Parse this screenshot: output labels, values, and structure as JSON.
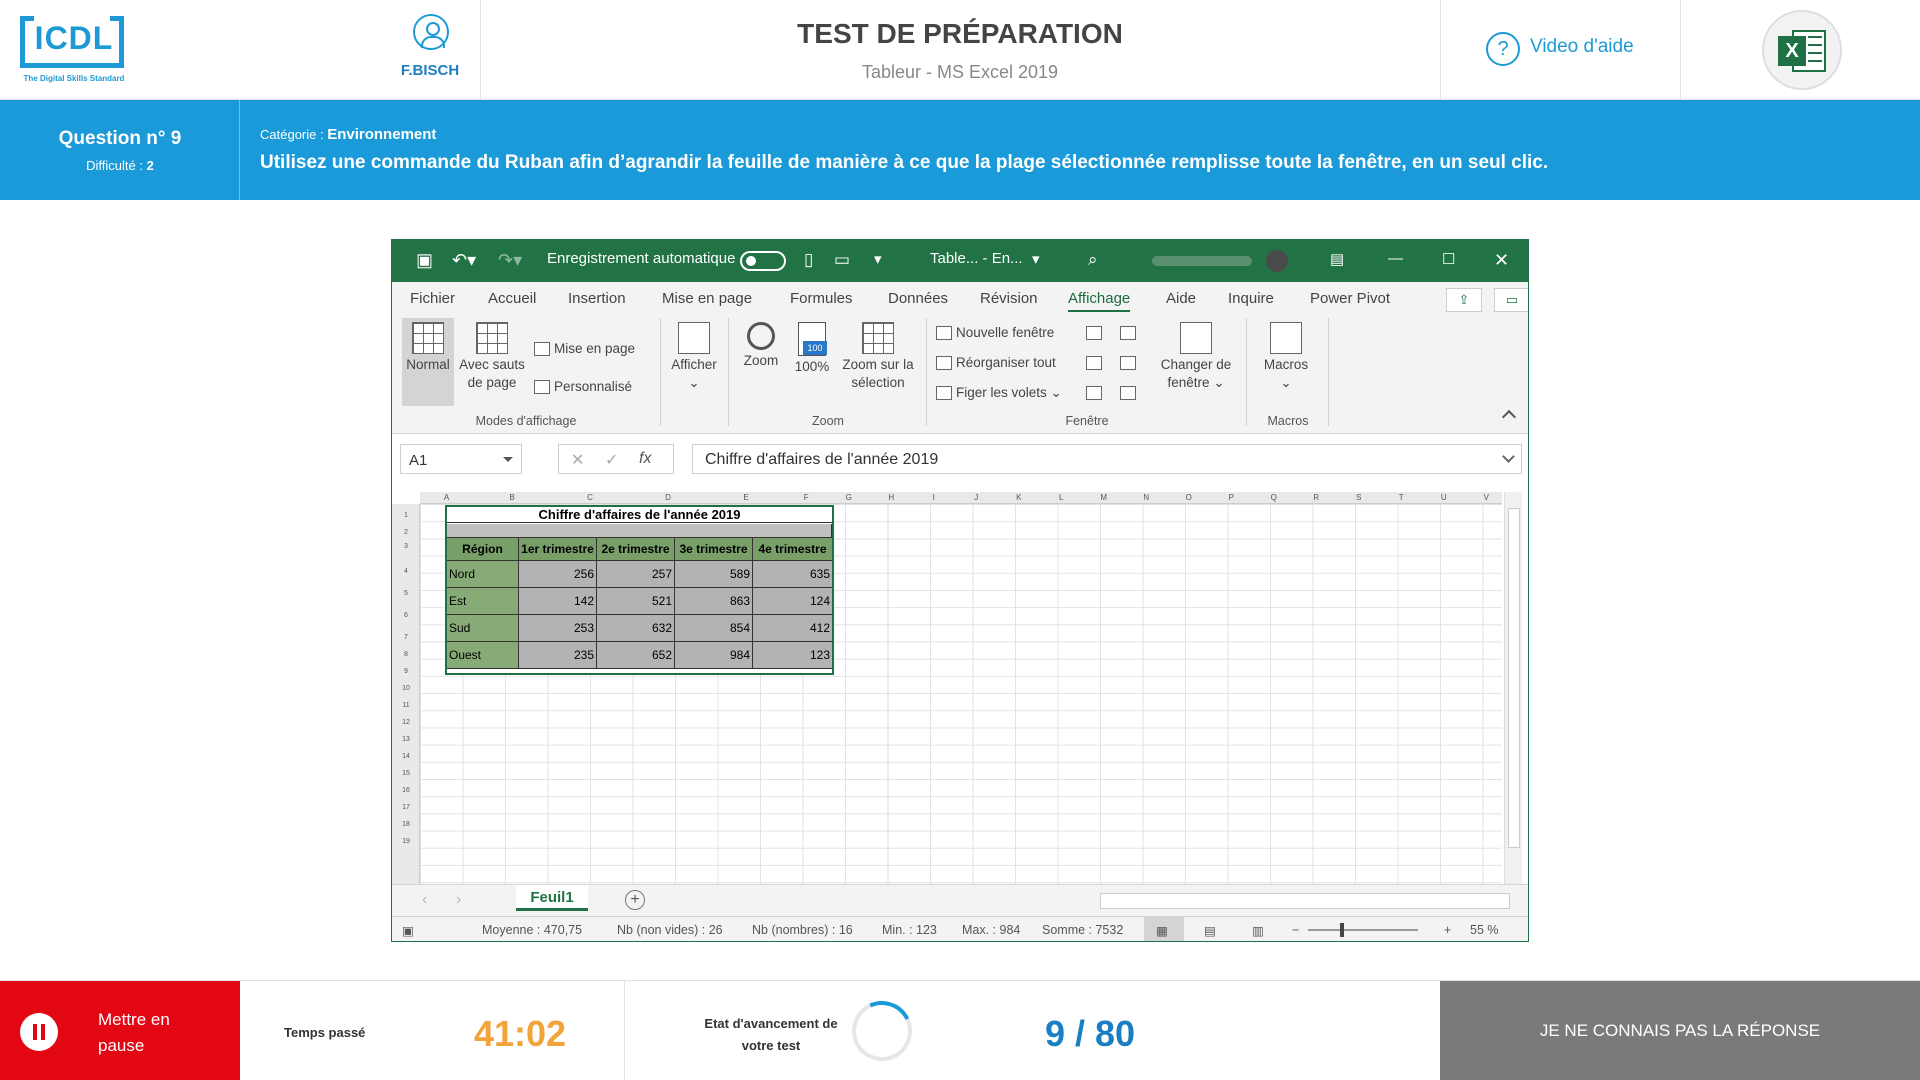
{
  "header": {
    "logo_text": "ICDL",
    "logo_tagline": "The Digital Skills Standard",
    "user_name": "F.BISCH",
    "title": "TEST DE PRÉPARATION",
    "subtitle": "Tableur - MS Excel 2019",
    "help_label": "Video d'aide",
    "app_icon_letter": "X",
    "icons": [
      "user-icon",
      "help-icon",
      "excel-icon"
    ]
  },
  "question": {
    "number_label": "Question n° 9",
    "difficulty_label": "Difficulté :",
    "difficulty_value": "2",
    "category_label": "Catégorie :",
    "category_value": "Environnement",
    "text": "Utilisez une commande du Ruban afin d’agrandir la feuille de manière à ce que la plage sélectionnée remplisse toute la fenêtre, en un seul clic."
  },
  "excel": {
    "autosave_label": "Enregistrement automatique",
    "file_name": "Table... - En...",
    "menu": [
      "Fichier",
      "Accueil",
      "Insertion",
      "Mise en page",
      "Formules",
      "Données",
      "Révision",
      "Affichage",
      "Aide",
      "Inquire",
      "Power Pivot"
    ],
    "active_menu": "Affichage",
    "ribbon": {
      "normal": "Normal",
      "page_breaks": "Avec sauts de page",
      "page_layout": "Mise en page",
      "custom": "Personnalisé",
      "group_views": "Modes d'affichage",
      "show": "Afficher",
      "zoom": "Zoom",
      "zoom100": "100%",
      "zoom_selection": "Zoom sur la sélection",
      "group_zoom": "Zoom",
      "new_window": "Nouvelle fenêtre",
      "arrange_all": "Réorganiser tout",
      "freeze_panes": "Figer les volets",
      "switch_windows": "Changer de fenêtre",
      "group_window": "Fenêtre",
      "macros": "Macros",
      "group_macros": "Macros"
    },
    "name_box": "A1",
    "formula_symbols": {
      "cancel": "✕",
      "enter": "✓",
      "fx": "fx"
    },
    "formula_value": "Chiffre d'affaires de l'année 2019",
    "columns": [
      "A",
      "B",
      "C",
      "D",
      "E",
      "F",
      "G",
      "H",
      "I",
      "J",
      "K",
      "L",
      "M",
      "N",
      "O",
      "P",
      "Q",
      "R",
      "S",
      "T",
      "U",
      "V"
    ],
    "rows": [
      "1",
      "2",
      "3",
      "4",
      "5",
      "6",
      "7",
      "8",
      "9",
      "10",
      "11",
      "12",
      "13",
      "14",
      "15",
      "16",
      "17",
      "18",
      "19"
    ],
    "table_title": "Chiffre d'affaires de l'année 2019",
    "table_headers": [
      "Région",
      "1er trimestre",
      "2e trimestre",
      "3e trimestre",
      "4e trimestre"
    ],
    "table_rows": [
      [
        "Nord",
        "256",
        "257",
        "589",
        "635"
      ],
      [
        "Est",
        "142",
        "521",
        "863",
        "124"
      ],
      [
        "Sud",
        "253",
        "632",
        "854",
        "412"
      ],
      [
        "Ouest",
        "235",
        "652",
        "984",
        "123"
      ]
    ],
    "sheet_tab": "Feuil1",
    "status": {
      "average": "Moyenne : 470,75",
      "count": "Nb (non vides) : 26",
      "numcount": "Nb (nombres) : 16",
      "min": "Min. : 123",
      "max": "Max. : 984",
      "sum": "Somme : 7532",
      "zoom_minus": "−",
      "zoom_plus": "+",
      "zoom": "55 %"
    }
  },
  "footer": {
    "pause_label": "Mettre en pause",
    "time_label": "Temps passé",
    "time_value": "41:02",
    "progress_label": "Etat d'avancement de votre test",
    "progress_value": "9 / 80",
    "dont_know_label": "JE NE CONNAIS PAS LA RÉPONSE"
  },
  "colors": {
    "brand_blue": "#1a9ad8",
    "excel_green": "#217346",
    "pause_red": "#e30613",
    "timer_orange": "#f2a33a"
  }
}
